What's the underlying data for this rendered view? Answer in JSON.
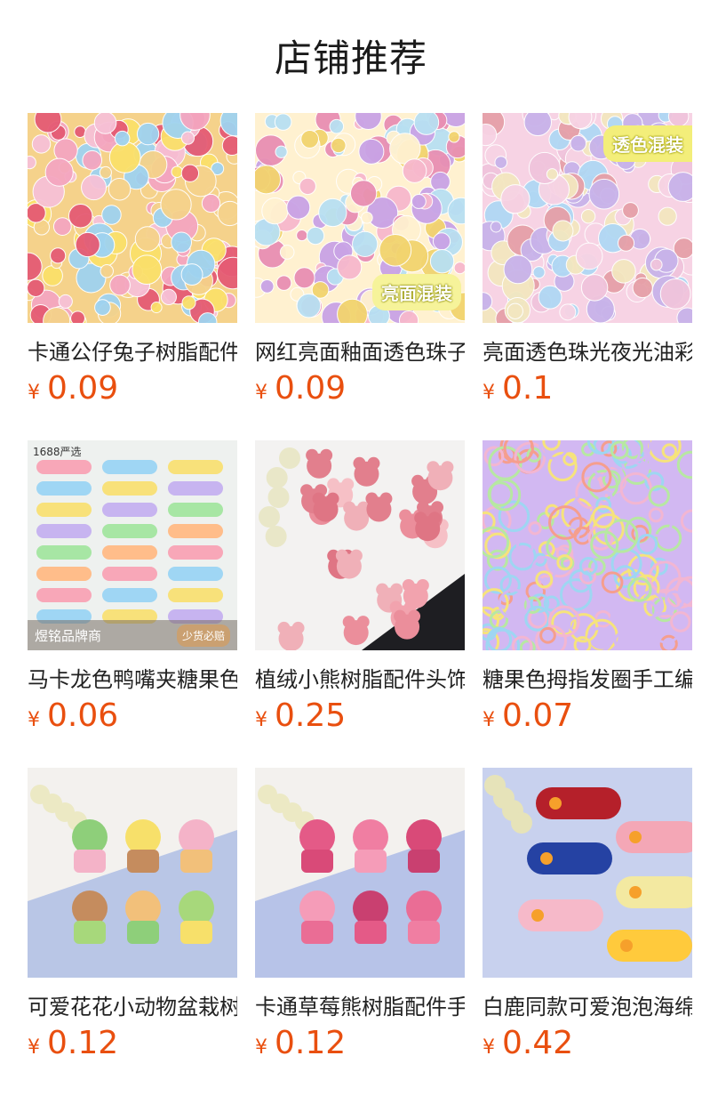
{
  "header": {
    "title": "店铺推荐"
  },
  "currency_symbol": "¥",
  "products": [
    {
      "name": "卡通公仔兔子树脂配件",
      "price": "0.09",
      "colors": [
        "#f4a6c0",
        "#fbe06a",
        "#9fd3f0",
        "#f7c1d6",
        "#e55b74",
        "#f5d28b"
      ]
    },
    {
      "name": "网红亮面釉面透色珠子",
      "price": "0.09",
      "badge_bottom": "亮面混装",
      "colors": [
        "#f7b8cc",
        "#f2d46f",
        "#b8e0f2",
        "#e88fb3",
        "#c9a3e6",
        "#fff1d0"
      ]
    },
    {
      "name": "亮面透色珠光夜光油彩",
      "price": "0.1",
      "badge_top": "透色混装",
      "colors": [
        "#f0c4dc",
        "#c8b3ea",
        "#f3e7c0",
        "#e6a0a8",
        "#b0d8f4",
        "#f7d3e4"
      ]
    },
    {
      "name": "马卡龙色鸭嘴夹糖果色",
      "price": "0.06",
      "corner_tag": "1688严选",
      "brand_left": "煜铭品牌商",
      "brand_right": "少货必赔",
      "colors": [
        "#f8a7b8",
        "#9fd6f4",
        "#f8e17a",
        "#c7b4f0",
        "#a7e6a4",
        "#ffbd8a"
      ]
    },
    {
      "name": "植绒小熊树脂配件头饰",
      "price": "0.25",
      "colors": [
        "#eb8e9b",
        "#f2a3ae",
        "#e27f8d",
        "#f6c0c6",
        "#df7584",
        "#f0b0b8"
      ]
    },
    {
      "name": "糖果色拇指发圈手工编织",
      "price": "0.07",
      "colors": [
        "#f2b6d2",
        "#9ed6f2",
        "#f6e37c",
        "#b7e8a2",
        "#f59e8e",
        "#d2b8f2"
      ]
    },
    {
      "name": "可爱花花小动物盆栽树脂",
      "price": "0.12",
      "colors": [
        "#8ecf7a",
        "#f7e06a",
        "#f4b3c8",
        "#c58c5e",
        "#f2c07a",
        "#a7d87b"
      ]
    },
    {
      "name": "卡通草莓熊树脂配件手机",
      "price": "0.12",
      "colors": [
        "#e45a87",
        "#f07ea2",
        "#d94a78",
        "#f59cb8",
        "#c94070",
        "#ea6d95"
      ]
    },
    {
      "name": "白鹿同款可爱泡泡海绵发夹",
      "price": "0.42",
      "colors": [
        "#b5202a",
        "#f4a7b6",
        "#2542a3",
        "#f3e9a1",
        "#f6b9c9",
        "#ffca3c"
      ]
    }
  ]
}
